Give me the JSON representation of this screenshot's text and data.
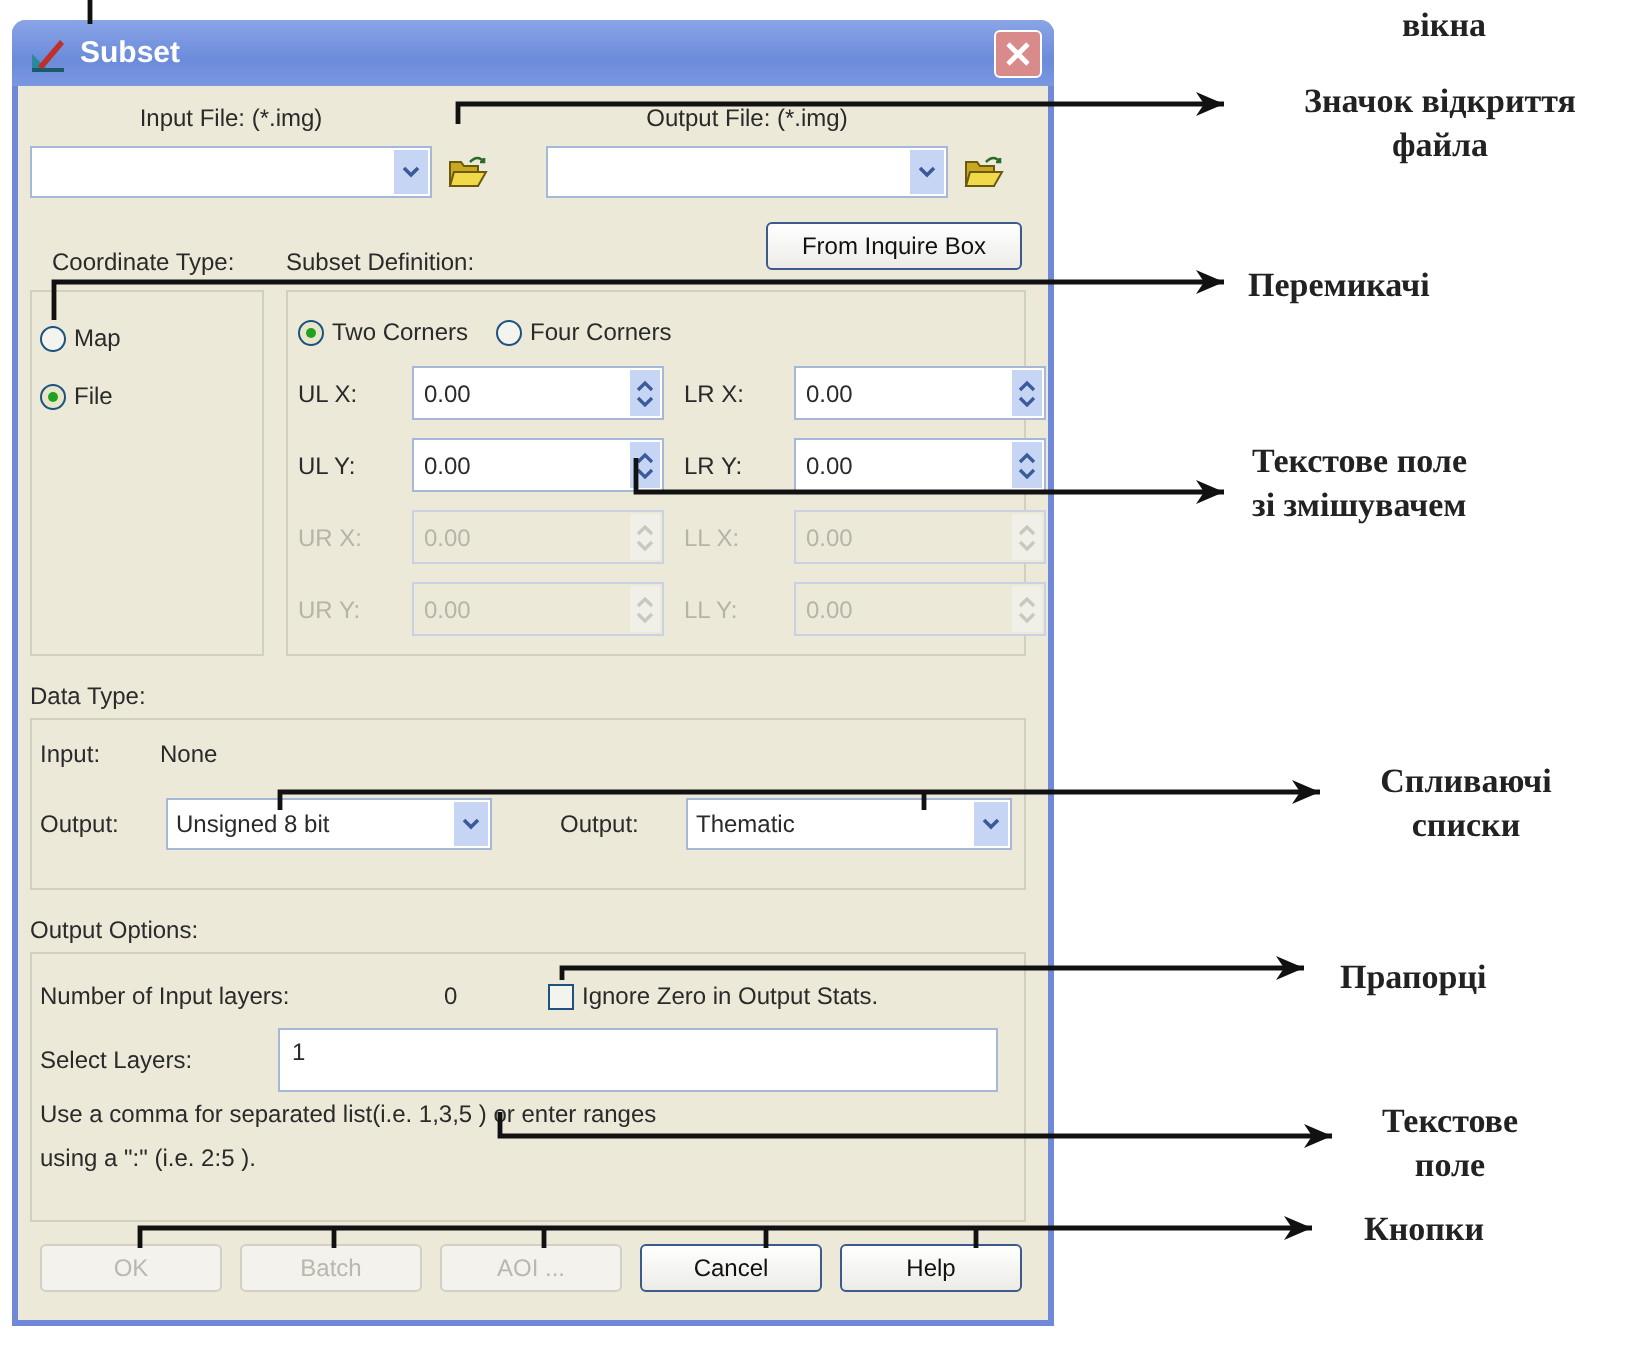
{
  "window": {
    "title": "Subset"
  },
  "file_fields": [
    {
      "label": "Input File: (*.img)"
    },
    {
      "label": "Output File: (*.img)"
    }
  ],
  "inquire_button": {
    "label": "From Inquire Box"
  },
  "coordinate_type": {
    "label": "Coordinate Type:",
    "options": [
      {
        "label": "Map",
        "selected": false
      },
      {
        "label": "File",
        "selected": true
      }
    ]
  },
  "subset_definition": {
    "label": "Subset Definition:",
    "modes": [
      {
        "label": "Two Corners",
        "selected": true
      },
      {
        "label": "Four Corners",
        "selected": false
      }
    ],
    "fields": [
      {
        "label": "UL X:",
        "value": "0.00",
        "disabled": false
      },
      {
        "label": "LR X:",
        "value": "0.00",
        "disabled": false
      },
      {
        "label": "UL Y:",
        "value": "0.00",
        "disabled": false
      },
      {
        "label": "LR Y:",
        "value": "0.00",
        "disabled": false
      },
      {
        "label": "UR X:",
        "value": "0.00",
        "disabled": true
      },
      {
        "label": "LL X:",
        "value": "0.00",
        "disabled": true
      },
      {
        "label": "UR Y:",
        "value": "0.00",
        "disabled": true
      },
      {
        "label": "LL Y:",
        "value": "0.00",
        "disabled": true
      }
    ]
  },
  "data_type": {
    "label": "Data Type:",
    "input_label": "Input:",
    "input_value": "None",
    "outputs": [
      {
        "label": "Output:",
        "value": "Unsigned 8 bit"
      },
      {
        "label": "Output:",
        "value": "Thematic"
      }
    ]
  },
  "output_options": {
    "label": "Output Options:",
    "layers_label": "Number of Input layers:",
    "layers_count": "0",
    "ignore_zero": {
      "label": "Ignore Zero in Output Stats.",
      "checked": false
    },
    "select_label": "Select Layers:",
    "select_value": "1",
    "help": [
      "Use a comma for separated list(i.e. 1,3,5 ) or enter ranges",
      "using a \":\" (i.e. 2:5 )."
    ]
  },
  "buttons": [
    {
      "label": "OK",
      "disabled": true
    },
    {
      "label": "Batch",
      "disabled": true
    },
    {
      "label": "AOI ...",
      "disabled": true
    },
    {
      "label": "Cancel",
      "disabled": false
    },
    {
      "label": "Help",
      "disabled": false
    }
  ],
  "annotations": [
    {
      "lines": [
        "вікна"
      ]
    },
    {
      "lines": [
        "Значок відкриття",
        "файла"
      ]
    },
    {
      "lines": [
        "Перемикачі"
      ]
    },
    {
      "lines": [
        "Текстове поле",
        "зі змішувачем"
      ]
    },
    {
      "lines": [
        "Спливаючі",
        "списки"
      ]
    },
    {
      "lines": [
        "Прапорці"
      ]
    },
    {
      "lines": [
        "Текстове",
        "поле"
      ]
    },
    {
      "lines": [
        "Кнопки"
      ]
    }
  ]
}
